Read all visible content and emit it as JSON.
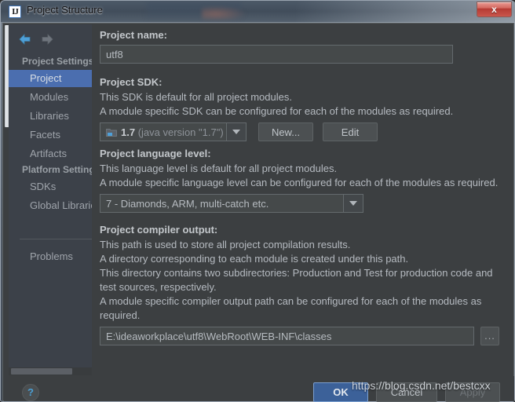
{
  "window": {
    "title": "Project Structure",
    "app_icon": "intellij-idea-icon",
    "close_label": "x"
  },
  "sidebar": {
    "nav": {
      "back_icon": "arrow-left-icon",
      "forward_icon": "arrow-right-icon"
    },
    "groups": [
      {
        "label": "Project Settings",
        "items": [
          {
            "label": "Project",
            "selected": true
          },
          {
            "label": "Modules",
            "selected": false
          },
          {
            "label": "Libraries",
            "selected": false
          },
          {
            "label": "Facets",
            "selected": false
          },
          {
            "label": "Artifacts",
            "selected": false
          }
        ]
      },
      {
        "label": "Platform Settings",
        "items": [
          {
            "label": "SDKs",
            "selected": false
          },
          {
            "label": "Global Libraries",
            "selected": false
          }
        ]
      }
    ],
    "extra_items": [
      {
        "label": "Problems",
        "selected": false
      }
    ]
  },
  "content": {
    "project_name": {
      "title": "Project name:",
      "value": "utf8",
      "placeholder": ""
    },
    "project_sdk": {
      "title": "Project SDK:",
      "lines": [
        "This SDK is default for all project modules.",
        "A module specific SDK can be configured for each of the modules as required."
      ],
      "icon": "sdk-folder-icon",
      "version": "1.7",
      "detail": "(java version \"1.7\")",
      "new_label": "New...",
      "edit_label": "Edit"
    },
    "language_level": {
      "title": "Project language level:",
      "lines": [
        "This language level is default for all project modules.",
        "A module specific language level can be configured for each of the modules as required."
      ],
      "value": "7 - Diamonds, ARM, multi-catch etc."
    },
    "compiler_output": {
      "title": "Project compiler output:",
      "lines": [
        "This path is used to store all project compilation results.",
        "A directory corresponding to each module is created under this path.",
        "This directory contains two subdirectories: Production and Test for production code and",
        "test sources, respectively.",
        "A module specific compiler output path can be configured for each of the modules as",
        "required."
      ],
      "value": "E:\\ideaworkplace\\utf8\\WebRoot\\WEB-INF\\classes",
      "browse_label": "..."
    }
  },
  "footer": {
    "help_label": "?",
    "ok_label": "OK",
    "cancel_label": "Cancel",
    "apply_label": "Apply"
  },
  "watermark": {
    "text": "https://blog.csdn.net/bestcxx"
  },
  "colors": {
    "accent": "#4b6eaf",
    "panel_bg": "#3c3f41",
    "sidebar_bg": "#3c4149",
    "field_bg": "#45494a",
    "text": "#b5bac0",
    "ok_button": "#3c6199"
  }
}
